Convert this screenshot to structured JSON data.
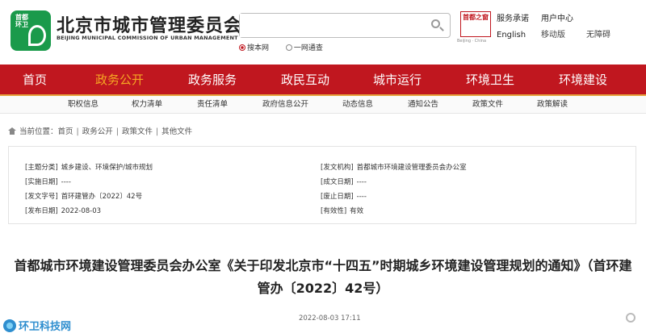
{
  "header": {
    "logo_text": "首都环卫",
    "site_name": "北京市城市管理委员会",
    "site_name_en": "BEIJING MUNICIPAL COMMISSION OF URBAN MANAGEMENT",
    "search": {
      "value": "",
      "placeholder": "",
      "options": [
        "搜本网",
        "一网通查"
      ],
      "selected": "搜本网"
    },
    "capital_logo_text": "首都之窗",
    "capital_logo_sub": "Beijing · China",
    "links": {
      "service": "服务承诺",
      "english": "English",
      "user_center": "用户中心",
      "mobile": "移动版",
      "accessible": "无障碍"
    }
  },
  "nav": {
    "items": [
      "首页",
      "政务公开",
      "政务服务",
      "政民互动",
      "城市运行",
      "环境卫生",
      "环境建设"
    ],
    "active": "政务公开"
  },
  "subnav": {
    "items": [
      "职权信息",
      "权力清单",
      "责任清单",
      "政府信息公开",
      "动态信息",
      "通知公告",
      "政策文件",
      "政策解读"
    ]
  },
  "breadcrumb": {
    "prefix": "当前位置：",
    "items": [
      "首页",
      "政务公开",
      "政策文件",
      "其他文件"
    ]
  },
  "meta": {
    "left": [
      {
        "label": "[主题分类]",
        "value": "城乡建设、环境保护/城市规划"
      },
      {
        "label": "[实施日期]",
        "value": "----"
      },
      {
        "label": "[发文字号]",
        "value": "首环建管办〔2022〕42号"
      },
      {
        "label": "[发布日期]",
        "value": "2022-08-03"
      }
    ],
    "right": [
      {
        "label": "[发文机构]",
        "value": "首都城市环境建设管理委员会办公室"
      },
      {
        "label": "[成文日期]",
        "value": "----"
      },
      {
        "label": "[废止日期]",
        "value": "----"
      },
      {
        "label": "[有效性]",
        "value": "有效"
      }
    ]
  },
  "document": {
    "title": "首都城市环境建设管理委员会办公室《关于印发北京市“十四五”时期城乡环境建设管理规划的通知》（首环建管办〔2022〕42号）",
    "date": "2022-08-03 17:11"
  },
  "watermark": {
    "text": "环卫科技网"
  },
  "colors": {
    "nav_red": "#c0171f",
    "nav_active": "#f5a623",
    "logo_green": "#1a9a4b",
    "watermark_blue": "#2e8ecf"
  }
}
